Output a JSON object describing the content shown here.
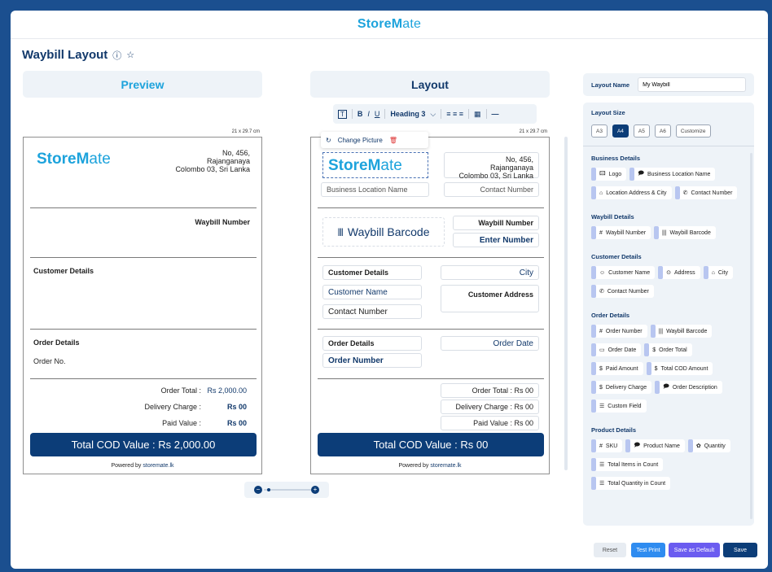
{
  "brand": {
    "name_bold": "Store",
    "name_mark": "M",
    "name_thin": "ate"
  },
  "page": {
    "title": "Waybill Layout",
    "info_icon": "ⓘ",
    "star_icon": "☆"
  },
  "preview": {
    "header": "Preview",
    "dims": "21 x 29.7 cm",
    "address": [
      "No, 456,",
      "Rajanganaya",
      "Colombo 03, Sri Lanka"
    ],
    "waybill_number": "Waybill Number",
    "customer_details": "Customer Details",
    "order_details": "Order Details",
    "order_no": "Order No.",
    "totals": [
      {
        "label": "Order Total :",
        "value": "Rs 2,000.00"
      },
      {
        "label": "Delivery Charge :",
        "value": "Rs 00"
      },
      {
        "label": "Paid Value :",
        "value": "Rs 00"
      }
    ],
    "cod": "Total COD Value : Rs 2,000.00",
    "powered_prefix": "Powered by ",
    "powered_link": "storemate.lk"
  },
  "layout": {
    "header": "Layout",
    "toolbar": {
      "text_icon": "T",
      "bold": "B",
      "italic": "I",
      "underline": "U",
      "heading": "Heading 3",
      "chevron": "⌵",
      "align": "≡ ≡ ≡",
      "table": "▦",
      "rule": "—"
    },
    "dims": "21 x 29.7 cm",
    "logo_toolbar": {
      "rotate_icon": "↻",
      "change_picture": "Change Picture",
      "delete_icon": "🗑"
    },
    "address": [
      "No, 456,",
      "Rajanganaya",
      "Colombo 03, Sri Lanka"
    ],
    "business_location": "Business Location Name",
    "contact_number": "Contact Number",
    "barcode": "Waybill Barcode",
    "barcode_icon": "||||",
    "waybill_number": "Waybill Number",
    "enter_number": "Enter Number",
    "customer_details": "Customer Details",
    "city": "City",
    "customer_name": "Customer Name",
    "customer_address": "Customer Address",
    "contact_number2": "Contact Number",
    "order_details": "Order Details",
    "order_date": "Order Date",
    "order_number": "Order Number",
    "totals": [
      "Order Total : Rs 00",
      "Delivery Charge : Rs 00",
      "Paid Value : Rs 00"
    ],
    "cod": "Total COD Value : Rs 00",
    "powered_prefix": "Powered by ",
    "powered_link": "storemate.lk"
  },
  "zoom": {
    "minus": "−",
    "plus": "+",
    "level_percent": 10
  },
  "sidebar": {
    "layout_name_label": "Layout Name",
    "layout_name_value": "My Waybill",
    "layout_size_label": "Layout Size",
    "sizes": [
      "A3",
      "A4",
      "A5",
      "A6",
      "Customize"
    ],
    "selected_size": "A4",
    "sections": [
      {
        "title": "Business Details",
        "fields": [
          {
            "icon": "🖾",
            "label": "Logo"
          },
          {
            "icon": "🗩",
            "label": "Business Location Name"
          },
          {
            "icon": "⌂",
            "label": "Location Address & City"
          },
          {
            "icon": "✆",
            "label": "Contact Number"
          }
        ]
      },
      {
        "title": "Waybill Details",
        "fields": [
          {
            "icon": "#",
            "label": "Waybill Number"
          },
          {
            "icon": "|||",
            "label": "Waybill Barcode"
          }
        ]
      },
      {
        "title": "Customer Details",
        "fields": [
          {
            "icon": "☺",
            "label": "Customer Name"
          },
          {
            "icon": "⊙",
            "label": "Address"
          },
          {
            "icon": "⌂",
            "label": "City"
          },
          {
            "icon": "✆",
            "label": "Contact Number"
          }
        ]
      },
      {
        "title": "Order Details",
        "fields": [
          {
            "icon": "#",
            "label": "Order Number"
          },
          {
            "icon": "|||",
            "label": "Waybill Barcode"
          },
          {
            "icon": "▭",
            "label": "Order Date"
          },
          {
            "icon": "$",
            "label": "Order Total"
          },
          {
            "icon": "$",
            "label": "Paid Amount"
          },
          {
            "icon": "$",
            "label": "Total COD Amount"
          },
          {
            "icon": "$",
            "label": "Delivery Charge"
          },
          {
            "icon": "🗩",
            "label": "Order Description"
          },
          {
            "icon": "☰",
            "label": "Custom Field"
          }
        ]
      },
      {
        "title": "Product Details",
        "fields": [
          {
            "icon": "#",
            "label": "SKU"
          },
          {
            "icon": "🗩",
            "label": "Product Name"
          },
          {
            "icon": "✿",
            "label": "Quantity"
          },
          {
            "icon": "☰",
            "label": "Total Items in Count"
          },
          {
            "icon": "☰",
            "label": "Total Quantity in Count"
          }
        ]
      }
    ]
  },
  "actions": {
    "reset": "Reset",
    "test_print": "Test Print",
    "save_default": "Save as Default",
    "save": "Save"
  },
  "colors": {
    "brand": "#1da3dc",
    "navy": "#0c3d78",
    "accent": "#2f8cf0",
    "purple": "#6b5cf0"
  }
}
